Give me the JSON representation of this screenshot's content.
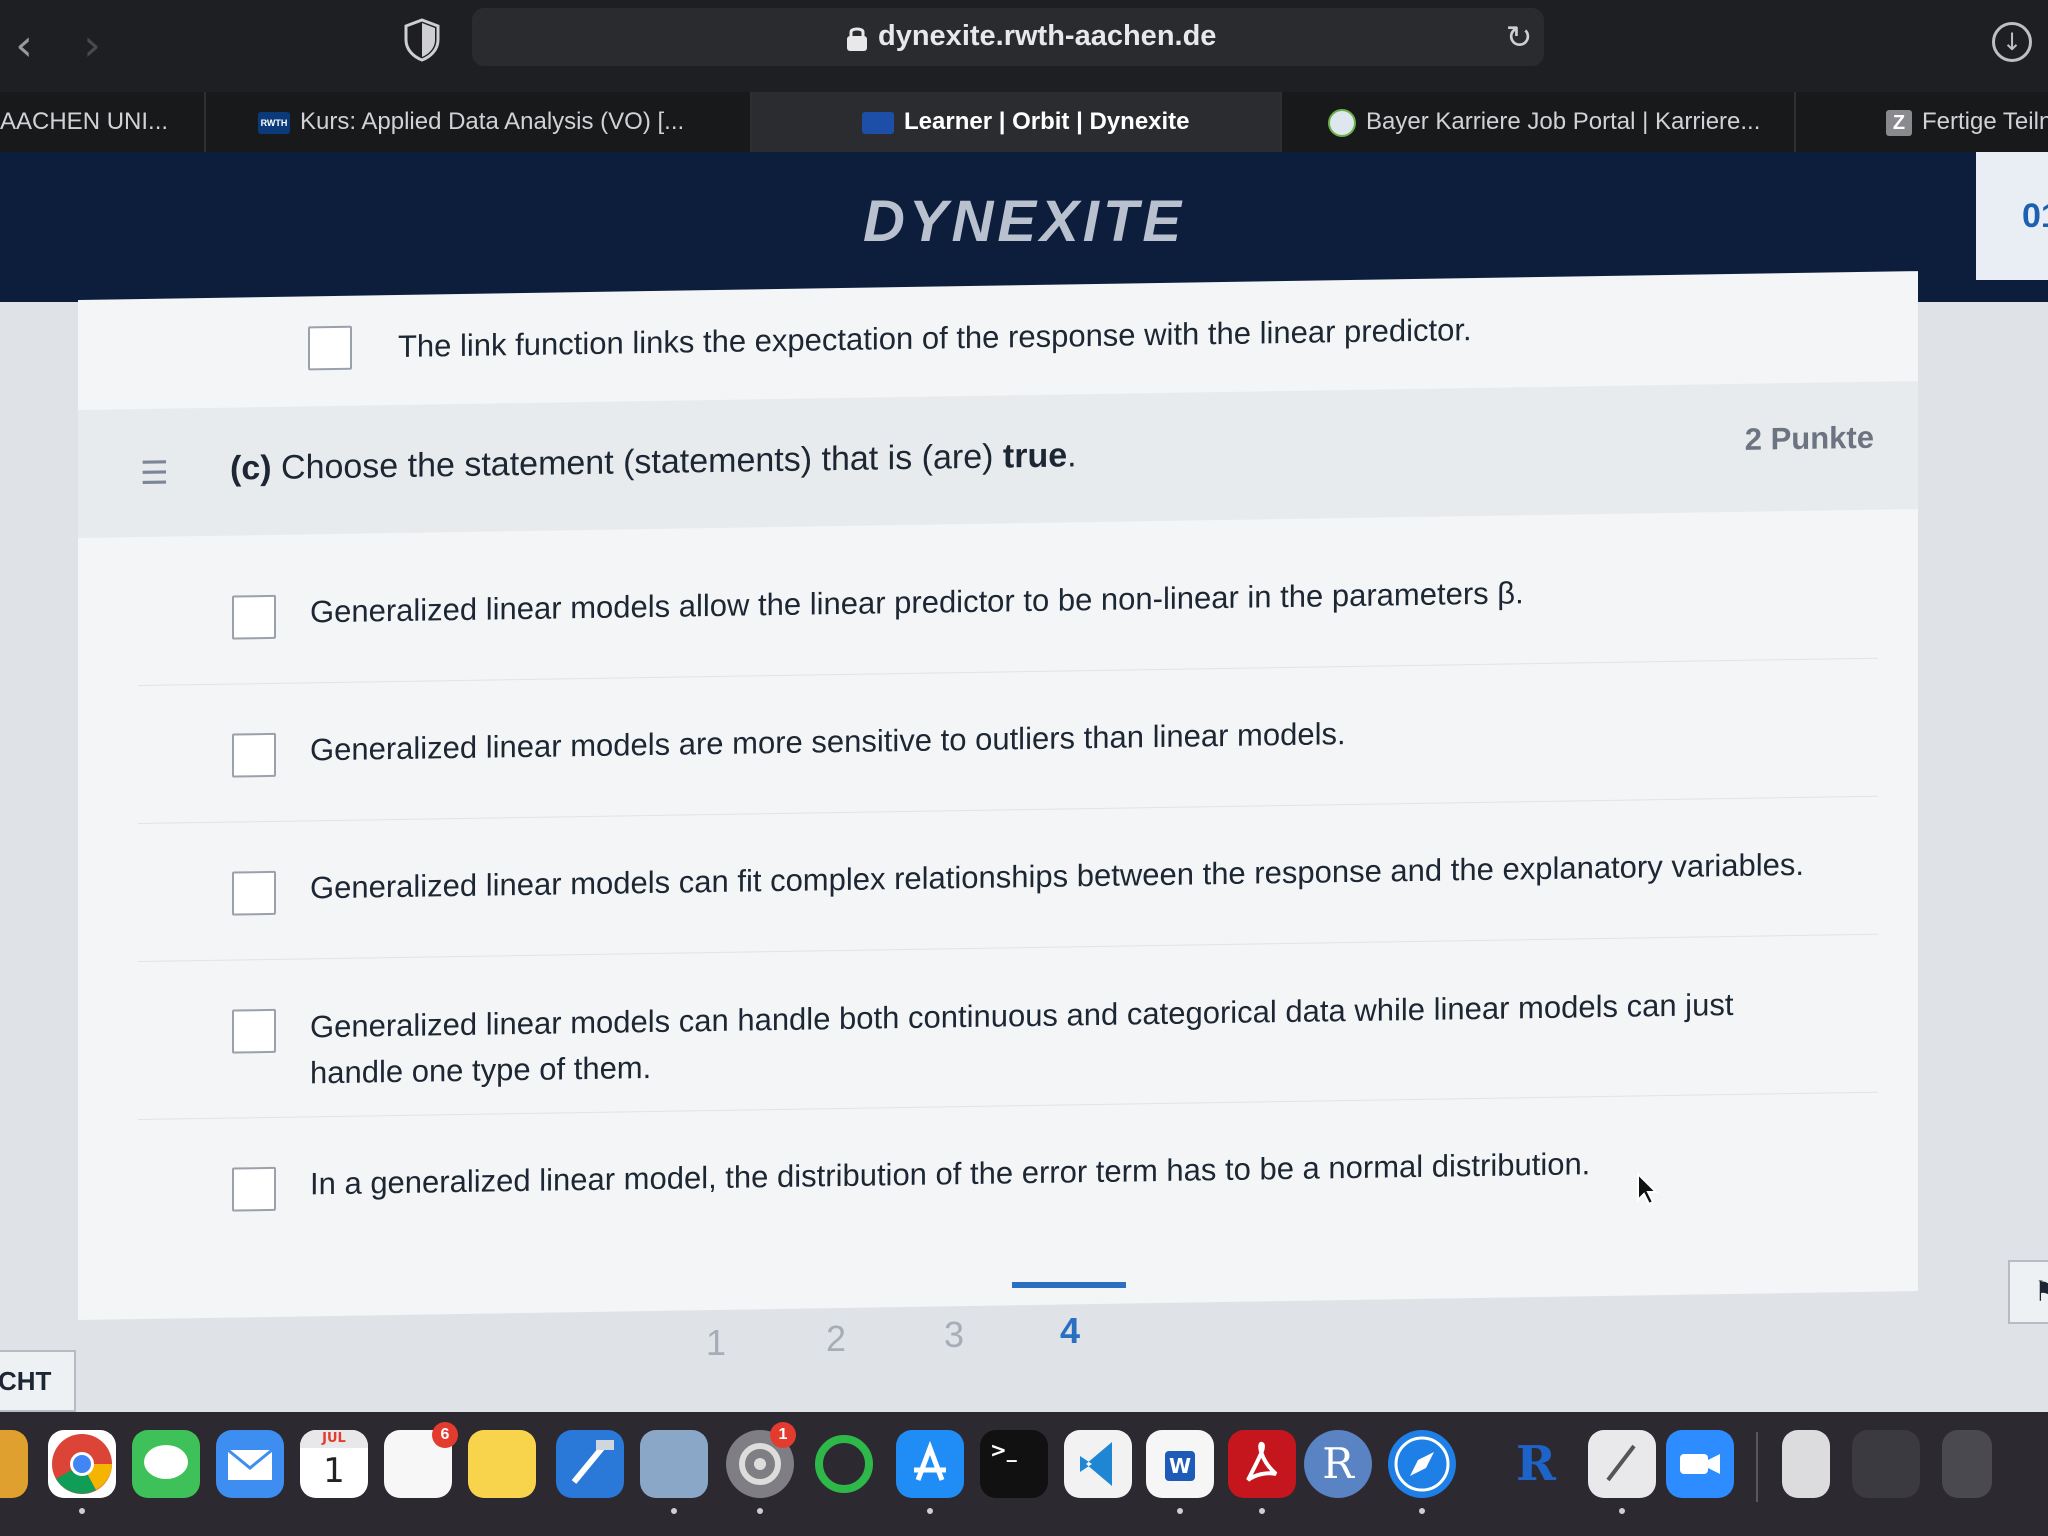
{
  "browser": {
    "url": "dynexite.rwth-aachen.de",
    "tabs": [
      {
        "label": "AACHEN UNI...",
        "favicon": "none"
      },
      {
        "label": "Kurs: Applied Data Analysis (VO) [...",
        "favicon": "rwth-logo"
      },
      {
        "label": "Learner | Orbit | Dynexite",
        "favicon": "dynexite-logo"
      },
      {
        "label": "Bayer Karriere Job Portal | Karriere...",
        "favicon": "bayer-logo"
      },
      {
        "label": "Fertige Teiln",
        "favicon": "z-icon"
      }
    ],
    "rwth_favicon_text": "RWTH",
    "z_favicon_text": "Z"
  },
  "header": {
    "logo_text": "DYNEXITE",
    "timer_fragment": "01"
  },
  "previous_option": {
    "text": "The link function links the expectation of the response with the linear predictor."
  },
  "question": {
    "prefix": "(c)",
    "text_before": "Choose the statement (statements) that is (are)",
    "bold_word": "true",
    "text_after": ".",
    "points": "2 Punkte"
  },
  "options": [
    {
      "text": "Generalized linear models allow the linear predictor to be non-linear in the parameters β.",
      "checked": false
    },
    {
      "text": "Generalized linear models are more sensitive to outliers than linear models.",
      "checked": false
    },
    {
      "text": "Generalized linear models can fit complex relationships between the response and the explanatory variables.",
      "checked": false
    },
    {
      "text": "Generalized linear models can handle both continuous and categorical data while linear models can just handle one type of them.",
      "checked": false
    },
    {
      "text": "In a generalized linear model, the distribution of the error term has to be a normal distribution.",
      "checked": false
    }
  ],
  "pagination": {
    "pages": [
      "1",
      "2",
      "3",
      "4"
    ],
    "current": "4"
  },
  "footer": {
    "back_label": "CHT"
  },
  "dock": {
    "calendar_month": "JUL",
    "calendar_day": "1",
    "reminders_badge": "6",
    "settings_badge": "1",
    "r_label": "R",
    "word_label": "W",
    "terminal_label": ">_"
  },
  "colors": {
    "accent": "#2b6fc2",
    "header_bg": "#0d1e3d",
    "card_bg": "#f3f5f7"
  }
}
